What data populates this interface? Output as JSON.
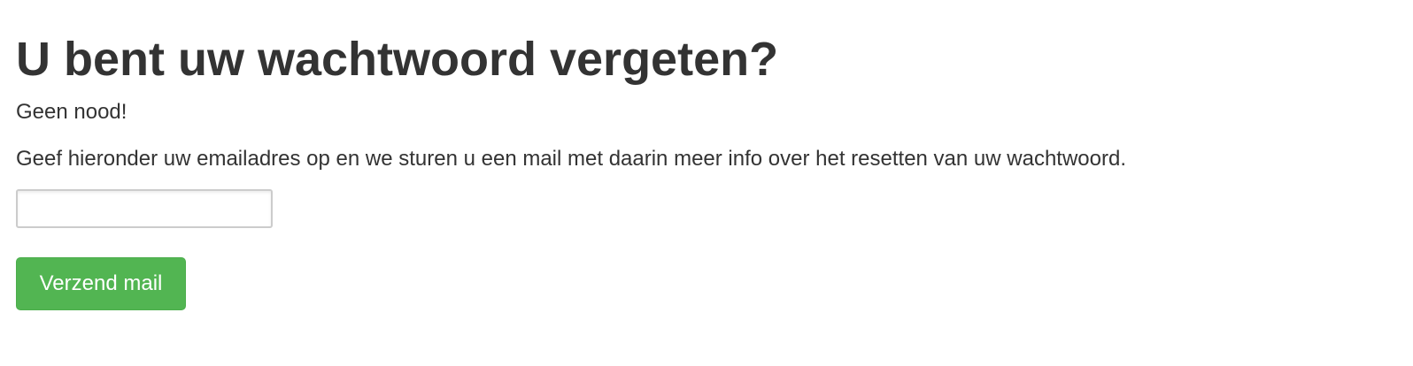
{
  "page": {
    "title": "U bent uw wachtwoord vergeten?",
    "subtitle": "Geen nood!",
    "instructions": "Geef hieronder uw emailadres op en we sturen u een mail met daarin meer info over het resetten van uw wachtwoord."
  },
  "form": {
    "email_value": "",
    "email_placeholder": "",
    "submit_label": "Verzend mail"
  },
  "colors": {
    "text": "#333333",
    "button_bg": "#52b552",
    "button_border": "#4cae4c",
    "input_border": "#cccccc"
  }
}
